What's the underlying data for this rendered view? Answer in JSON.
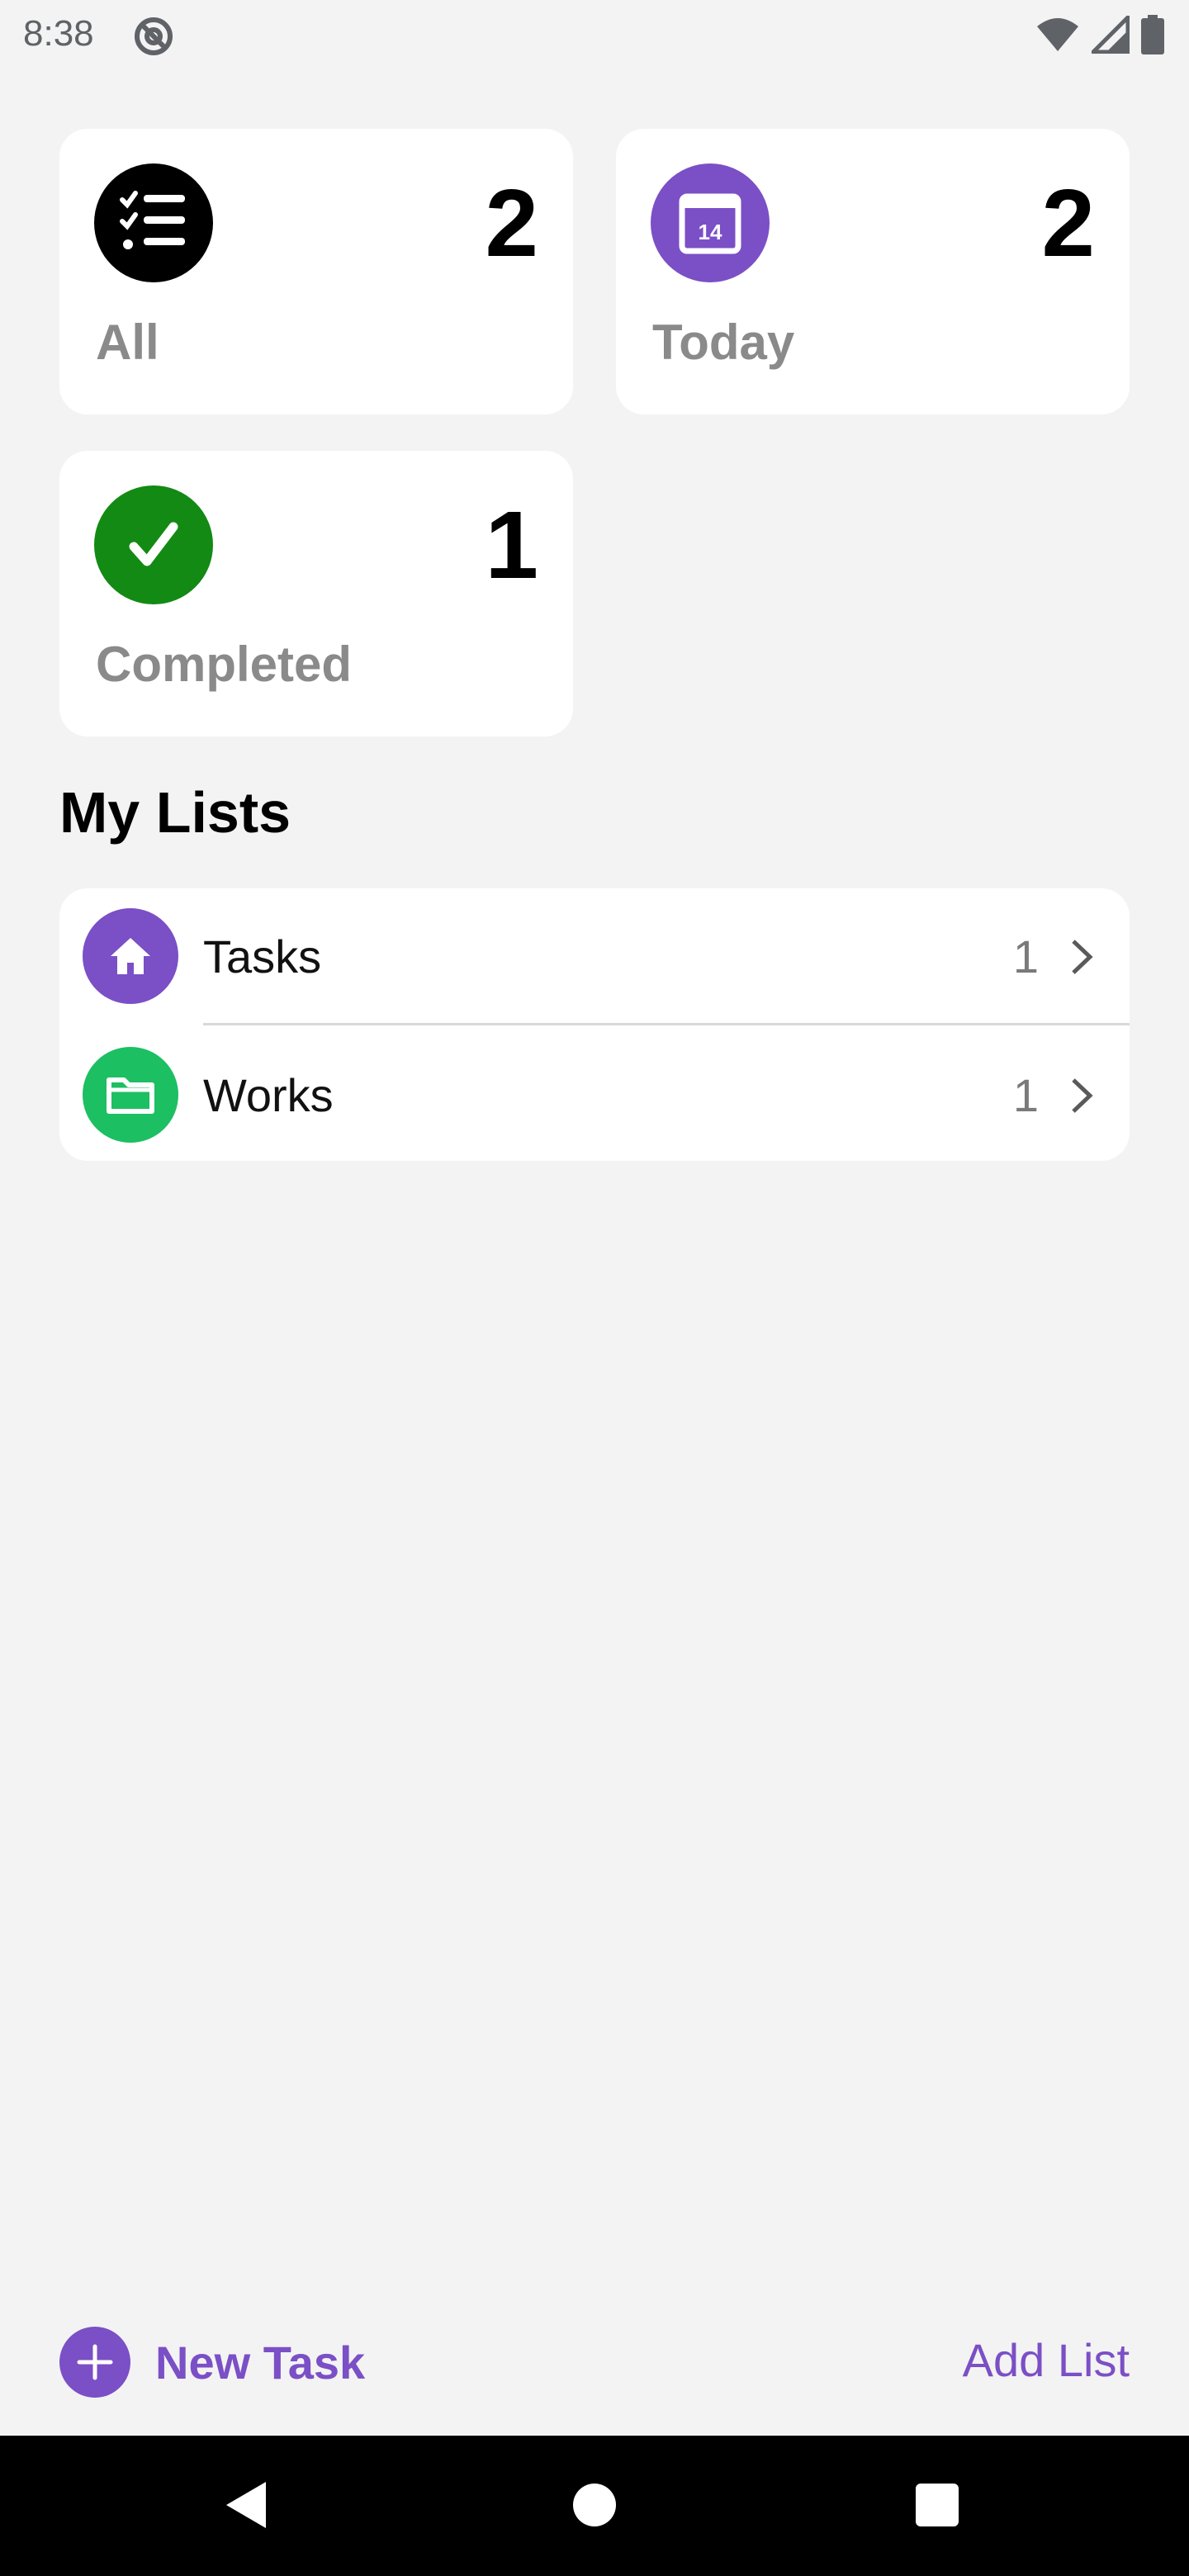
{
  "status_bar": {
    "time": "8:38",
    "icons": [
      "at-sign-icon",
      "wifi-icon",
      "signal-icon",
      "battery-icon"
    ]
  },
  "summary": {
    "all": {
      "label": "All",
      "count": "2",
      "icon": "checklist-icon",
      "color": "#000000"
    },
    "today": {
      "label": "Today",
      "count": "2",
      "icon": "calendar-icon",
      "day": "14",
      "color": "#7b4fc6"
    },
    "completed": {
      "label": "Completed",
      "count": "1",
      "icon": "checkmark-icon",
      "color": "#138a13"
    }
  },
  "my_lists": {
    "title": "My Lists",
    "items": [
      {
        "label": "Tasks",
        "count": "1",
        "icon": "home-icon",
        "color": "#7b4fc6"
      },
      {
        "label": "Works",
        "count": "1",
        "icon": "folder-icon",
        "color": "#1cbf62"
      }
    ]
  },
  "toolbar": {
    "new_task_label": "New Task",
    "add_list_label": "Add List",
    "accent": "#7b4fc6"
  },
  "nav_bar": {
    "icons": [
      "back-icon",
      "home-circle-icon",
      "recents-icon"
    ]
  }
}
